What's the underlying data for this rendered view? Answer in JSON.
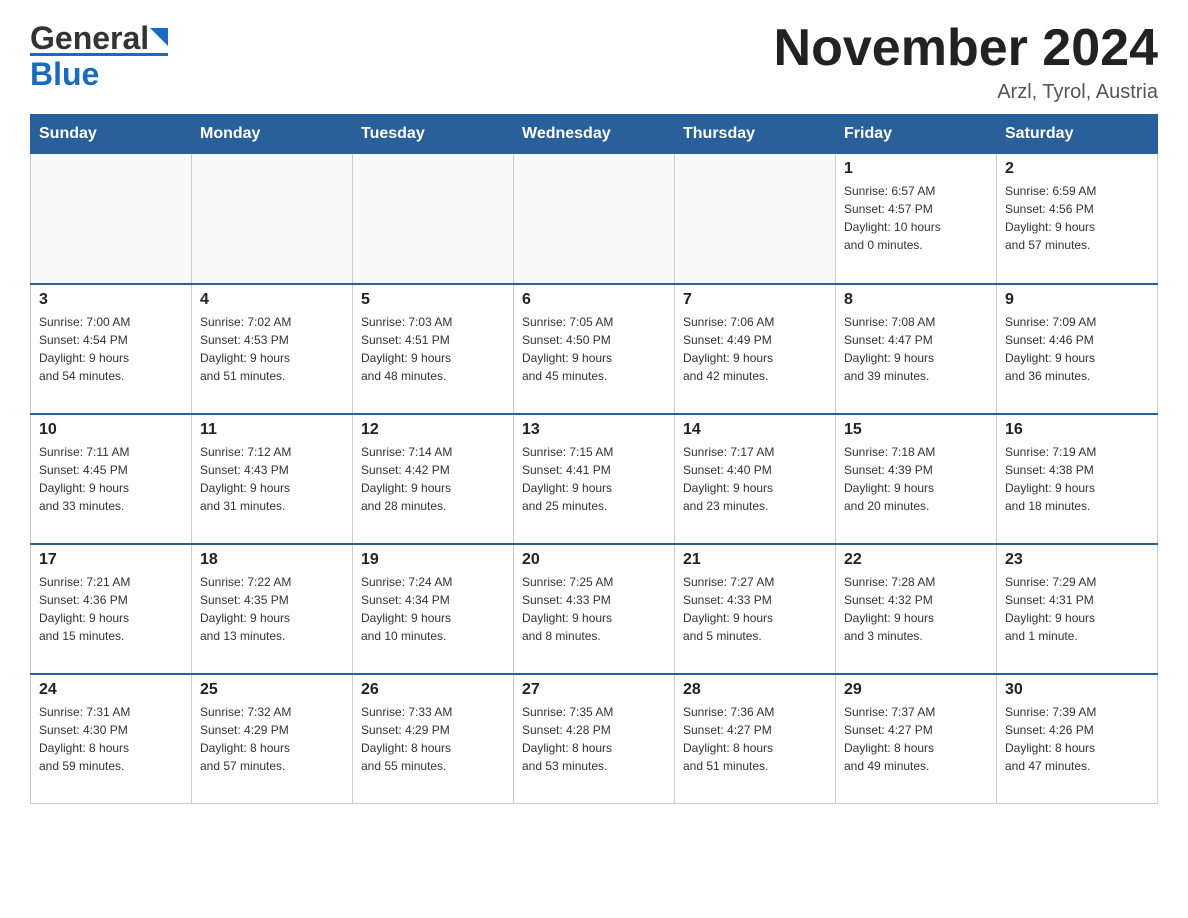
{
  "header": {
    "logo_general": "General",
    "logo_blue": "Blue",
    "month_title": "November 2024",
    "location": "Arzl, Tyrol, Austria"
  },
  "weekdays": [
    "Sunday",
    "Monday",
    "Tuesday",
    "Wednesday",
    "Thursday",
    "Friday",
    "Saturday"
  ],
  "weeks": [
    [
      {
        "day": "",
        "info": ""
      },
      {
        "day": "",
        "info": ""
      },
      {
        "day": "",
        "info": ""
      },
      {
        "day": "",
        "info": ""
      },
      {
        "day": "",
        "info": ""
      },
      {
        "day": "1",
        "info": "Sunrise: 6:57 AM\nSunset: 4:57 PM\nDaylight: 10 hours\nand 0 minutes."
      },
      {
        "day": "2",
        "info": "Sunrise: 6:59 AM\nSunset: 4:56 PM\nDaylight: 9 hours\nand 57 minutes."
      }
    ],
    [
      {
        "day": "3",
        "info": "Sunrise: 7:00 AM\nSunset: 4:54 PM\nDaylight: 9 hours\nand 54 minutes."
      },
      {
        "day": "4",
        "info": "Sunrise: 7:02 AM\nSunset: 4:53 PM\nDaylight: 9 hours\nand 51 minutes."
      },
      {
        "day": "5",
        "info": "Sunrise: 7:03 AM\nSunset: 4:51 PM\nDaylight: 9 hours\nand 48 minutes."
      },
      {
        "day": "6",
        "info": "Sunrise: 7:05 AM\nSunset: 4:50 PM\nDaylight: 9 hours\nand 45 minutes."
      },
      {
        "day": "7",
        "info": "Sunrise: 7:06 AM\nSunset: 4:49 PM\nDaylight: 9 hours\nand 42 minutes."
      },
      {
        "day": "8",
        "info": "Sunrise: 7:08 AM\nSunset: 4:47 PM\nDaylight: 9 hours\nand 39 minutes."
      },
      {
        "day": "9",
        "info": "Sunrise: 7:09 AM\nSunset: 4:46 PM\nDaylight: 9 hours\nand 36 minutes."
      }
    ],
    [
      {
        "day": "10",
        "info": "Sunrise: 7:11 AM\nSunset: 4:45 PM\nDaylight: 9 hours\nand 33 minutes."
      },
      {
        "day": "11",
        "info": "Sunrise: 7:12 AM\nSunset: 4:43 PM\nDaylight: 9 hours\nand 31 minutes."
      },
      {
        "day": "12",
        "info": "Sunrise: 7:14 AM\nSunset: 4:42 PM\nDaylight: 9 hours\nand 28 minutes."
      },
      {
        "day": "13",
        "info": "Sunrise: 7:15 AM\nSunset: 4:41 PM\nDaylight: 9 hours\nand 25 minutes."
      },
      {
        "day": "14",
        "info": "Sunrise: 7:17 AM\nSunset: 4:40 PM\nDaylight: 9 hours\nand 23 minutes."
      },
      {
        "day": "15",
        "info": "Sunrise: 7:18 AM\nSunset: 4:39 PM\nDaylight: 9 hours\nand 20 minutes."
      },
      {
        "day": "16",
        "info": "Sunrise: 7:19 AM\nSunset: 4:38 PM\nDaylight: 9 hours\nand 18 minutes."
      }
    ],
    [
      {
        "day": "17",
        "info": "Sunrise: 7:21 AM\nSunset: 4:36 PM\nDaylight: 9 hours\nand 15 minutes."
      },
      {
        "day": "18",
        "info": "Sunrise: 7:22 AM\nSunset: 4:35 PM\nDaylight: 9 hours\nand 13 minutes."
      },
      {
        "day": "19",
        "info": "Sunrise: 7:24 AM\nSunset: 4:34 PM\nDaylight: 9 hours\nand 10 minutes."
      },
      {
        "day": "20",
        "info": "Sunrise: 7:25 AM\nSunset: 4:33 PM\nDaylight: 9 hours\nand 8 minutes."
      },
      {
        "day": "21",
        "info": "Sunrise: 7:27 AM\nSunset: 4:33 PM\nDaylight: 9 hours\nand 5 minutes."
      },
      {
        "day": "22",
        "info": "Sunrise: 7:28 AM\nSunset: 4:32 PM\nDaylight: 9 hours\nand 3 minutes."
      },
      {
        "day": "23",
        "info": "Sunrise: 7:29 AM\nSunset: 4:31 PM\nDaylight: 9 hours\nand 1 minute."
      }
    ],
    [
      {
        "day": "24",
        "info": "Sunrise: 7:31 AM\nSunset: 4:30 PM\nDaylight: 8 hours\nand 59 minutes."
      },
      {
        "day": "25",
        "info": "Sunrise: 7:32 AM\nSunset: 4:29 PM\nDaylight: 8 hours\nand 57 minutes."
      },
      {
        "day": "26",
        "info": "Sunrise: 7:33 AM\nSunset: 4:29 PM\nDaylight: 8 hours\nand 55 minutes."
      },
      {
        "day": "27",
        "info": "Sunrise: 7:35 AM\nSunset: 4:28 PM\nDaylight: 8 hours\nand 53 minutes."
      },
      {
        "day": "28",
        "info": "Sunrise: 7:36 AM\nSunset: 4:27 PM\nDaylight: 8 hours\nand 51 minutes."
      },
      {
        "day": "29",
        "info": "Sunrise: 7:37 AM\nSunset: 4:27 PM\nDaylight: 8 hours\nand 49 minutes."
      },
      {
        "day": "30",
        "info": "Sunrise: 7:39 AM\nSunset: 4:26 PM\nDaylight: 8 hours\nand 47 minutes."
      }
    ]
  ]
}
